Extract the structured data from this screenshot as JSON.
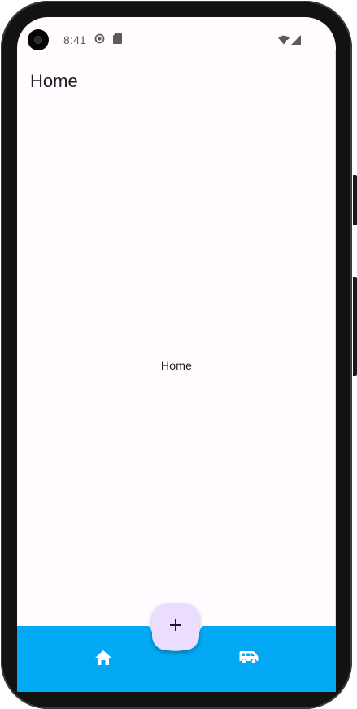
{
  "status_bar": {
    "time": "8:41"
  },
  "app_bar": {
    "title": "Home"
  },
  "body": {
    "label": "Home"
  },
  "fab": {
    "icon": "plus-icon"
  },
  "bottom_nav": {
    "background": "#03a9f4",
    "items": [
      {
        "icon": "home-icon"
      },
      {
        "icon": "van-icon"
      }
    ]
  },
  "colors": {
    "screen_background": "#fffbfe",
    "fab_background": "#eaddff",
    "bottom_bar": "#03a9f4"
  }
}
